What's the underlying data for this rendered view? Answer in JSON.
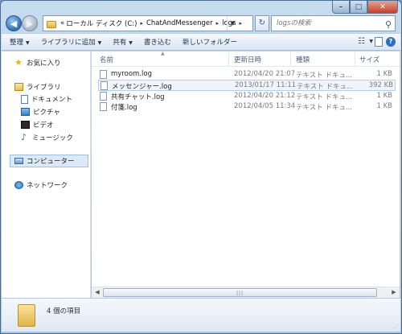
{
  "window_controls": {
    "minimize": "–",
    "maximize": "□",
    "close": "✕"
  },
  "address": {
    "overflow_marker": "«",
    "segments": [
      "ローカル ディスク (C:)",
      "ChatAndMessenger",
      "logs"
    ],
    "separator": "▸"
  },
  "search": {
    "placeholder": "logsの検索"
  },
  "toolbar": {
    "organize": "整理",
    "include_in_library": "ライブラリに追加",
    "share": "共有",
    "burn": "書き込む",
    "new_folder": "新しいフォルダー",
    "help": "?"
  },
  "nav": {
    "favorites": "お気に入り",
    "libraries": "ライブラリ",
    "documents": "ドキュメント",
    "pictures": "ピクチャ",
    "videos": "ビデオ",
    "music": "ミュージック",
    "computer": "コンピューター",
    "network": "ネットワーク"
  },
  "columns": {
    "name": "名前",
    "date": "更新日時",
    "type": "種類",
    "size": "サイズ"
  },
  "files": [
    {
      "name": "myroom.log",
      "date": "2012/04/20 21:07",
      "type": "テキスト ドキュ...",
      "size": "1 KB"
    },
    {
      "name": "メッセンジャー.log",
      "date": "2013/01/17 11:11",
      "type": "テキスト ドキュ...",
      "size": "392 KB"
    },
    {
      "name": "共有チャット.log",
      "date": "2012/04/20 21:12",
      "type": "テキスト ドキュ...",
      "size": "1 KB"
    },
    {
      "name": "付箋.log",
      "date": "2012/04/05 11:34",
      "type": "テキスト ドキュ...",
      "size": "1 KB"
    }
  ],
  "status": {
    "item_count": "4 個の項目"
  }
}
